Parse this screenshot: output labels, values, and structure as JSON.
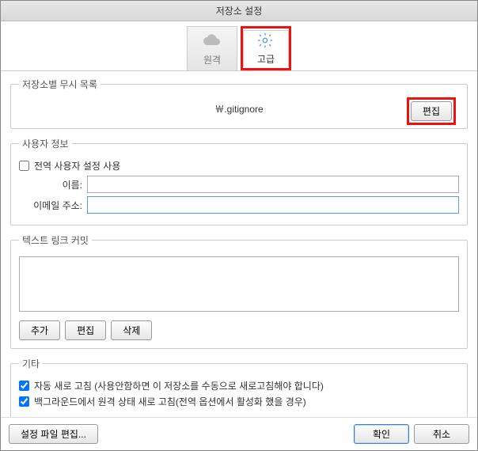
{
  "dialog": {
    "title": "저장소 설정"
  },
  "tabs": {
    "remote": {
      "label": "원격"
    },
    "advanced": {
      "label": "고급"
    }
  },
  "ignore": {
    "legend": "저장소별 무시 목록",
    "path": "￦.gitignore",
    "edit_btn": "편집"
  },
  "user": {
    "legend": "사용자 정보",
    "use_global": "전역 사용자 설정 사용",
    "name_label": "이름:",
    "name_value": "",
    "email_label": "이메일 주소:",
    "email_value": ""
  },
  "textlink": {
    "legend": "텍스트 링크 커밋",
    "value": "",
    "add_btn": "추가",
    "edit_btn": "편집",
    "delete_btn": "삭제"
  },
  "other": {
    "legend": "기타",
    "auto_refresh": "자동 새로 고침 (사용안함하면 이 저장소를 수동으로 새로고침해야 합니다)",
    "bg_refresh": "백그라운드에서 원격 상태 새로 고침(전역 옵션에서 활성화 했을 경우)"
  },
  "footer": {
    "edit_config": "설정 파일 편집...",
    "ok": "확인",
    "cancel": "취소"
  }
}
